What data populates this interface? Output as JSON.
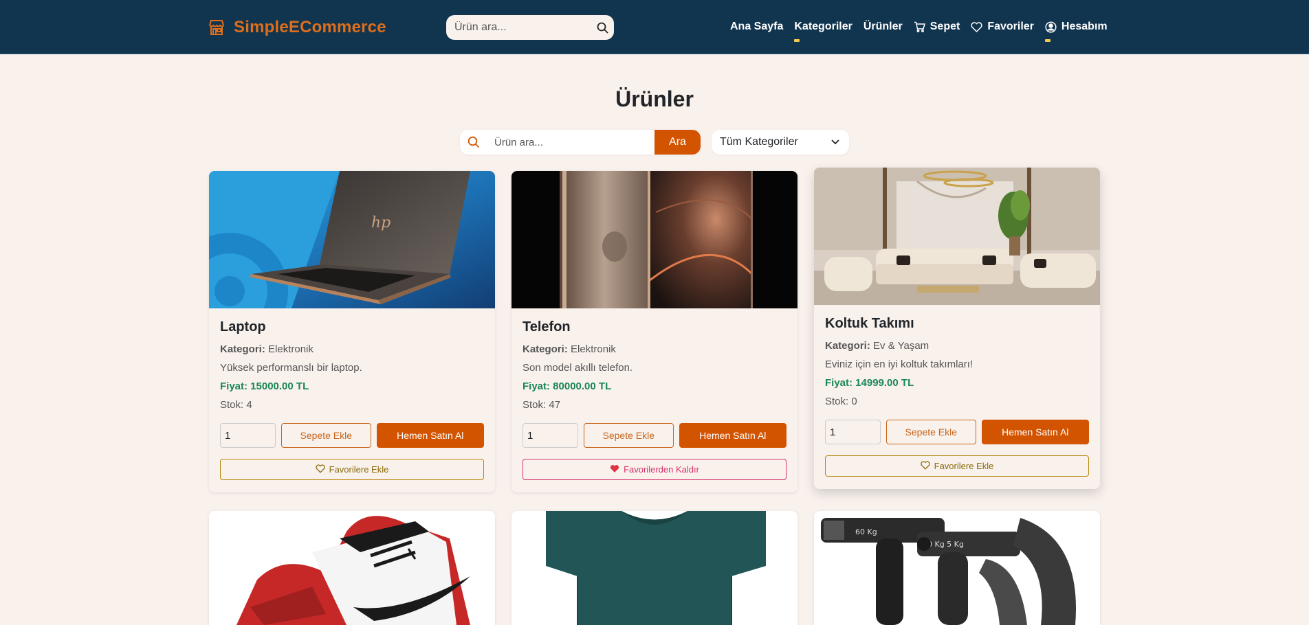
{
  "colors": {
    "navbar": "#11344f",
    "brand": "#dd6f1d",
    "accent": "#d35400",
    "price": "#198754",
    "background": "#f9f1ec"
  },
  "navbar": {
    "brand": "SimpleECommerce",
    "brand_icon": "store-icon",
    "search_placeholder": "Ürün ara...",
    "links": {
      "home": "Ana Sayfa",
      "categories": "Kategoriler",
      "products": "Ürünler",
      "cart": "Sepet",
      "favorites": "Favoriler",
      "account": "Hesabım"
    }
  },
  "page": {
    "title": "Ürünler",
    "search_placeholder": "Ürün ara...",
    "search_button": "Ara",
    "category_filter": "Tüm Kategoriler"
  },
  "labels": {
    "category": "Kategori:",
    "add_to_cart": "Sepete Ekle",
    "buy_now": "Hemen Satın Al",
    "add_favorite": "Favorilere Ekle",
    "remove_favorite": "Favorilerden Kaldır"
  },
  "products": [
    {
      "name": "Laptop",
      "category": "Elektronik",
      "description": "Yüksek performanslı bir laptop.",
      "price": "Fiyat: 15000.00 TL",
      "stock": "Stok: 4",
      "quantity": "1",
      "favorite": false
    },
    {
      "name": "Telefon",
      "category": "Elektronik",
      "description": "Son model akıllı telefon.",
      "price": "Fiyat: 80000.00 TL",
      "stock": "Stok: 47",
      "quantity": "1",
      "favorite": true
    },
    {
      "name": "Koltuk Takımı",
      "category": "Ev & Yaşam",
      "description": "Eviniz için en iyi koltuk takımları!",
      "price": "Fiyat: 14999.00 TL",
      "stock": "Stok: 0",
      "quantity": "1",
      "favorite": false
    }
  ]
}
